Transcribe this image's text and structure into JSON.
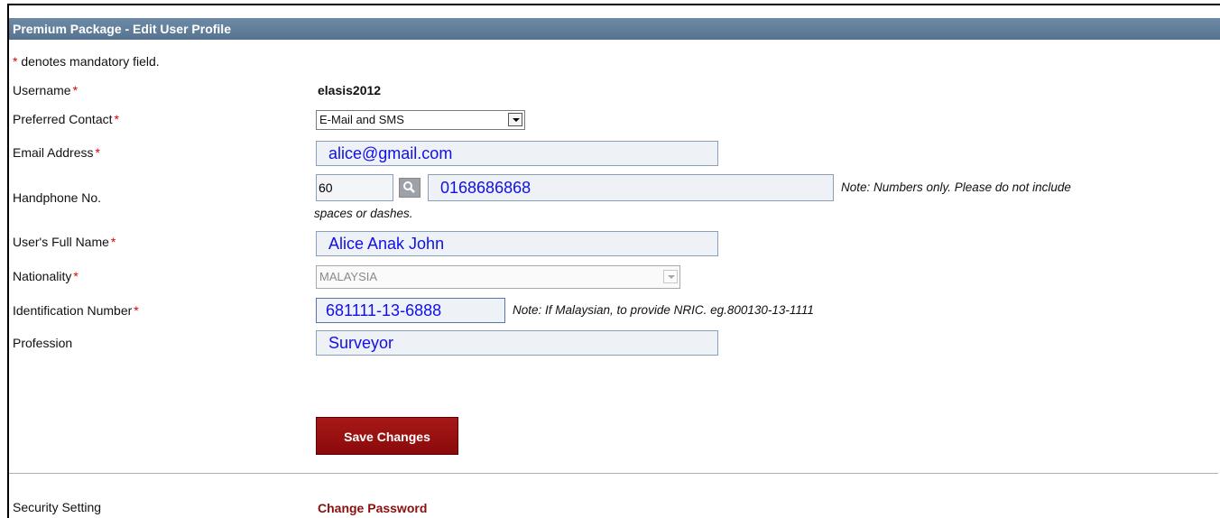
{
  "header": {
    "title": "Premium Package - Edit User Profile"
  },
  "form": {
    "mandatory_star": "*",
    "mandatory_note": "denotes mandatory field.",
    "username": {
      "label": "Username",
      "value": "elasis2012"
    },
    "preferred_contact": {
      "label": "Preferred Contact",
      "value": "E-Mail and SMS"
    },
    "email": {
      "label": "Email Address",
      "value": "alice@gmail.com"
    },
    "handphone": {
      "label": "Handphone No.",
      "country_code": "60",
      "number": "0168686868",
      "note_line1": "Note: Numbers only. Please do not include",
      "note_line2": "spaces or dashes."
    },
    "full_name": {
      "label": "User's Full Name",
      "value": "Alice Anak John"
    },
    "nationality": {
      "label": "Nationality",
      "value": "MALAYSIA"
    },
    "identification": {
      "label": "Identification Number",
      "value": "681111-13-6888",
      "note": "Note: If Malaysian, to provide NRIC. eg.800130-13-1111"
    },
    "profession": {
      "label": "Profession",
      "value": "Surveyor"
    },
    "save_label": "Save Changes"
  },
  "security": {
    "label": "Security Setting",
    "link": "Change Password"
  },
  "icons": {
    "search": "search-icon",
    "dropdown": "chevron-down-icon"
  },
  "colors": {
    "header": "#6481a0",
    "button": "#9b1212",
    "input_text": "#1010e8",
    "required": "#e00000"
  }
}
